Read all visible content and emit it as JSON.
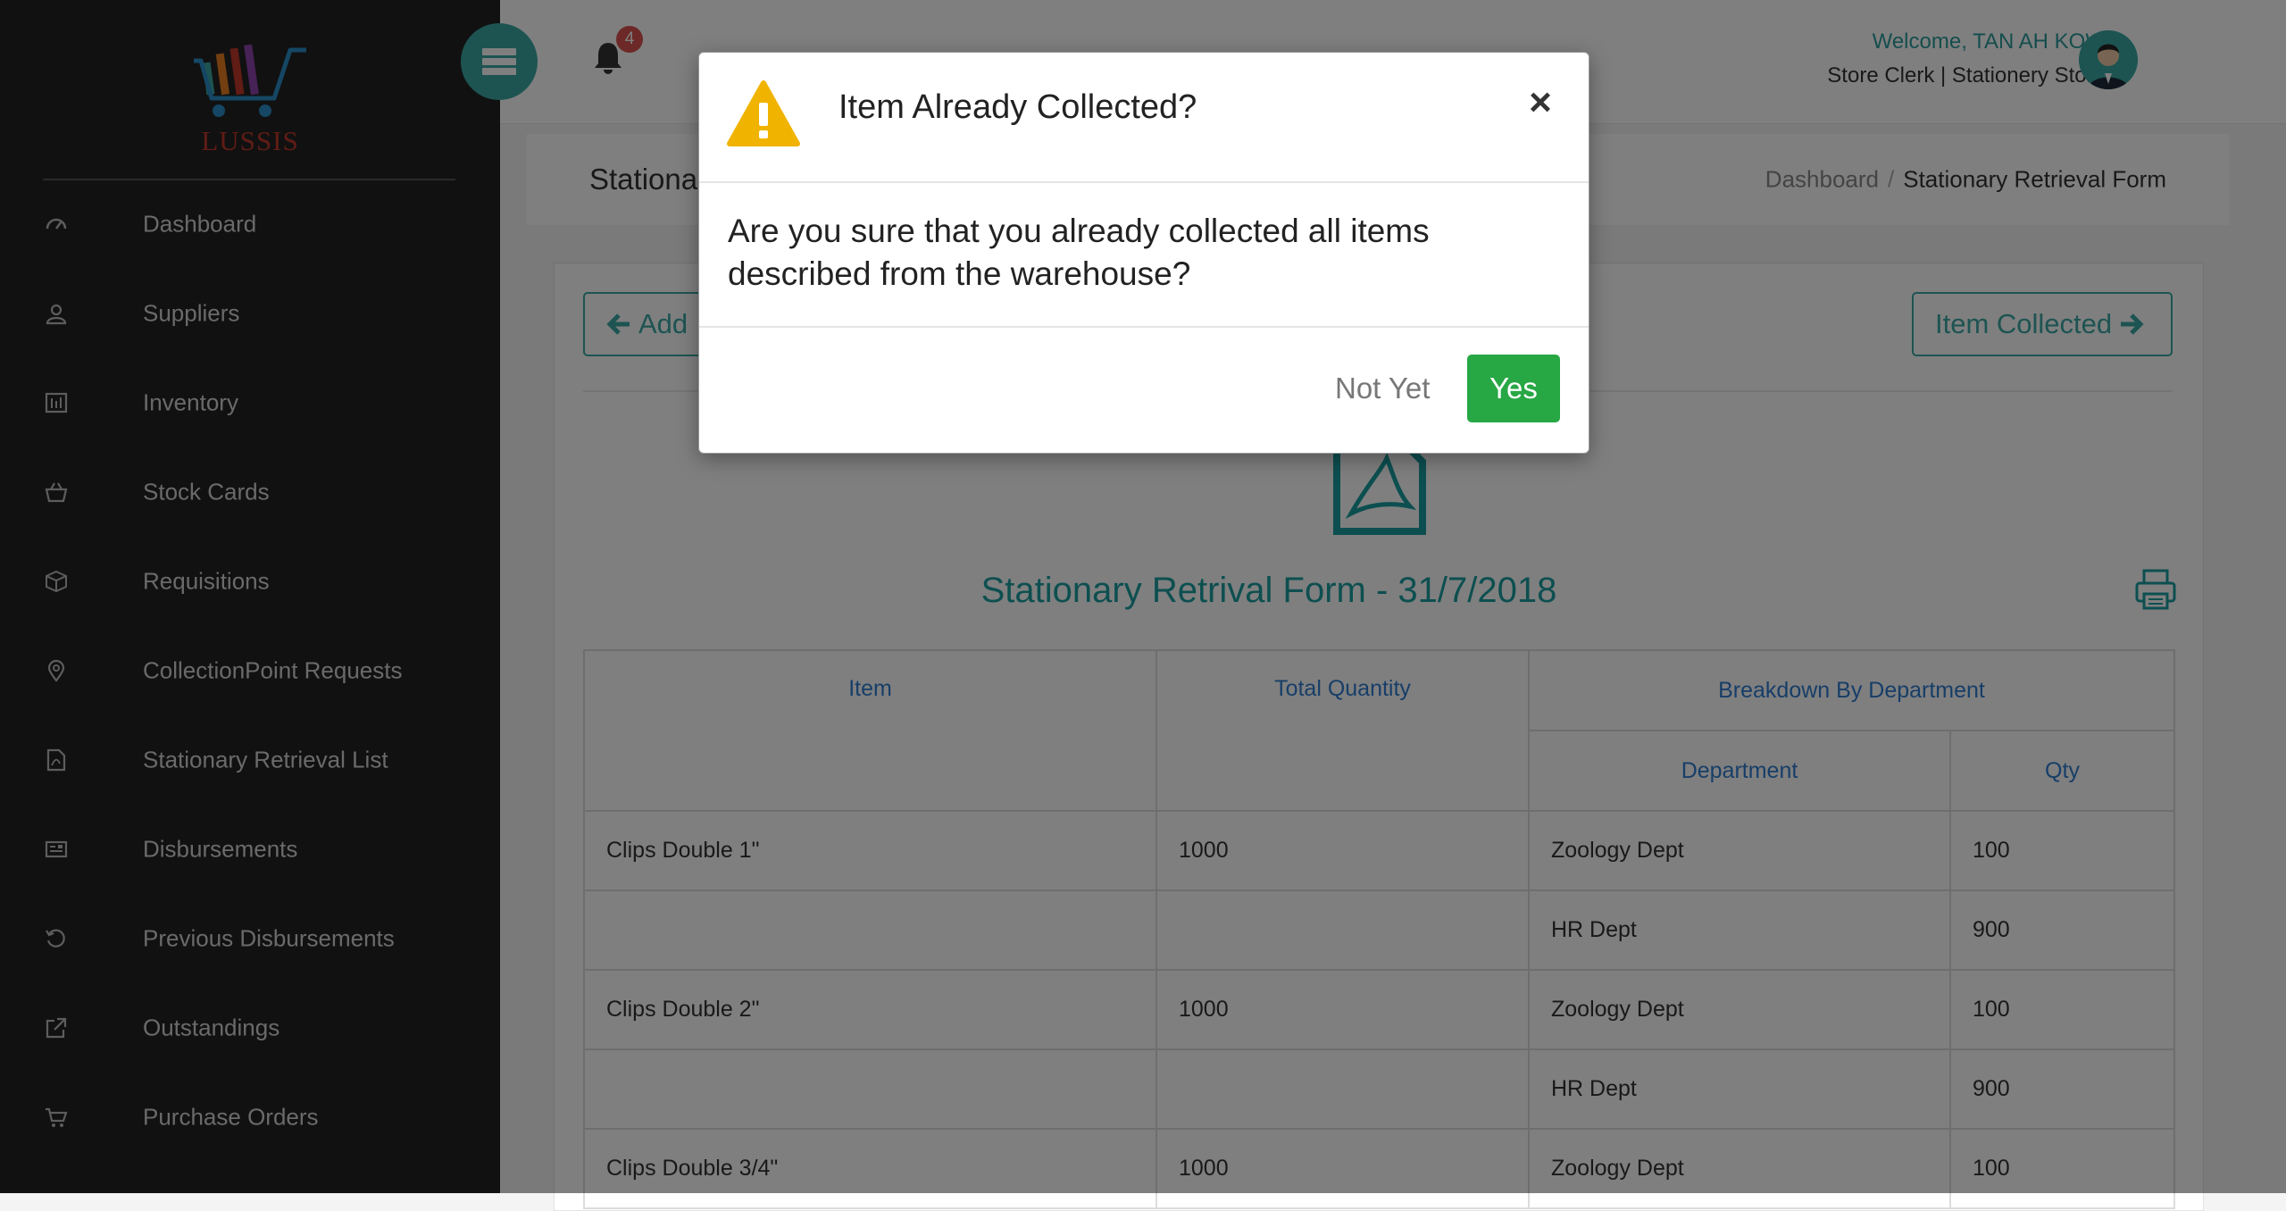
{
  "app": {
    "logo_text": "LUSSIS"
  },
  "sidebar": {
    "items": [
      {
        "label": "Dashboard",
        "icon": "dashboard-icon"
      },
      {
        "label": "Suppliers",
        "icon": "user-icon"
      },
      {
        "label": "Inventory",
        "icon": "inventory-icon"
      },
      {
        "label": "Stock Cards",
        "icon": "basket-icon"
      },
      {
        "label": "Requisitions",
        "icon": "box-icon"
      },
      {
        "label": "CollectionPoint Requests",
        "icon": "map-pin-icon"
      },
      {
        "label": "Stationary Retrieval List",
        "icon": "pdf-file-icon"
      },
      {
        "label": "Disbursements",
        "icon": "newspaper-icon"
      },
      {
        "label": "Previous Disbursements",
        "icon": "history-icon"
      },
      {
        "label": "Outstandings",
        "icon": "external-link-icon"
      },
      {
        "label": "Purchase Orders",
        "icon": "cart-icon"
      }
    ]
  },
  "header": {
    "notification_count": "4",
    "welcome": "Welcome, TAN AH KOW",
    "role": "Store Clerk | Stationery Store"
  },
  "title_bar": {
    "title": "Stationary Retrieval Form",
    "breadcrumb": {
      "home": "Dashboard",
      "current": "Stationary Retrieval Form"
    }
  },
  "content": {
    "back_button": "Add",
    "next_button": "Item Collected",
    "form_title": "Stationary Retrival Form - 31/7/2018",
    "table": {
      "headers": {
        "item": "Item",
        "total_quantity": "Total Quantity",
        "breakdown": "Breakdown By Department",
        "department": "Department",
        "qty": "Qty"
      },
      "rows": [
        {
          "item": "Clips Double 1\"",
          "total": "1000",
          "department": "Zoology Dept",
          "qty": "100"
        },
        {
          "item": "",
          "total": "",
          "department": "HR Dept",
          "qty": "900"
        },
        {
          "item": "Clips Double 2\"",
          "total": "1000",
          "department": "Zoology Dept",
          "qty": "100"
        },
        {
          "item": "",
          "total": "",
          "department": "HR Dept",
          "qty": "900"
        },
        {
          "item": "Clips Double 3/4\"",
          "total": "1000",
          "department": "Zoology Dept",
          "qty": "100"
        }
      ]
    }
  },
  "modal": {
    "title": "Item Already Collected?",
    "close_symbol": "×",
    "body": "Are you sure that you already collected all items described from the warehouse?",
    "cancel_label": "Not Yet",
    "confirm_label": "Yes"
  },
  "colors": {
    "accent": "#3aa9a4",
    "sidebar_bg": "#222222",
    "confirm": "#28a745",
    "warning": "#f0b400",
    "badge": "#d9534f",
    "table_header": "#2f7cd1"
  }
}
